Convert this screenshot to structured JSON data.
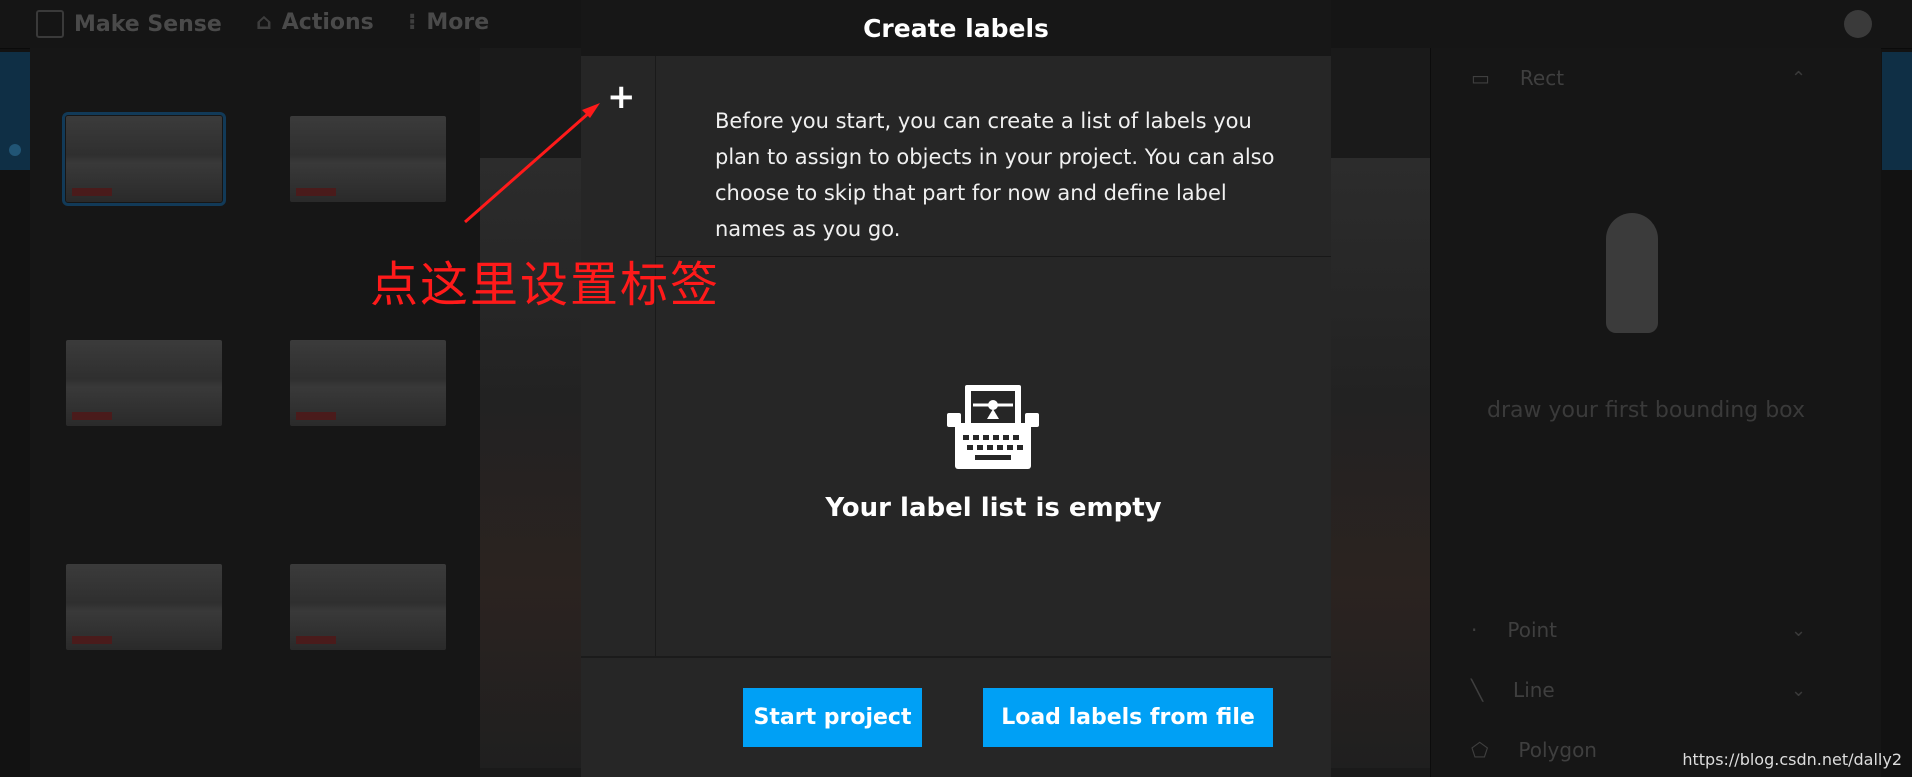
{
  "app": {
    "title": "Make Sense",
    "menu": [
      "Actions",
      "More"
    ]
  },
  "right_panel": {
    "top_tool": "Rect",
    "empty_message": "draw your first bounding box",
    "tools": [
      "Point",
      "Line",
      "Polygon"
    ]
  },
  "modal": {
    "title": "Create labels",
    "add_icon": "+",
    "intro": "Before you start, you can create a list of labels you plan to assign to objects in your project. You can also choose to skip that part for now and define label names as you go.",
    "empty_text": "Your label list is empty",
    "buttons": {
      "start": "Start project",
      "load": "Load labels from file"
    }
  },
  "annotation": {
    "text": "点这里设置标签",
    "color": "#ff1a1a"
  },
  "watermark": "https://blog.csdn.net/dally2",
  "colors": {
    "accent": "#00a0f5",
    "modal_bg": "#262626",
    "header_bg": "#171717"
  }
}
